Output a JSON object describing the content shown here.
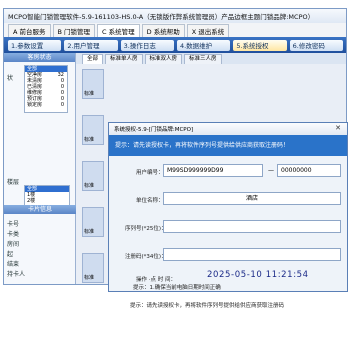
{
  "window": {
    "title": "MCPO智能门锁管理软件-5.9-161103-HS.0-A（无锁版作弊系统管理员）产品边框主题门锁品牌:MCPO）"
  },
  "menubar": {
    "items": [
      "A  前台服务",
      "B  门锁管理",
      "C  系统管理",
      "D  系统帮助",
      "X  退出系统"
    ]
  },
  "tabs": {
    "items": [
      "1.参数设置",
      "2.用户管理",
      "3.操作日志",
      "4.数据维护",
      "5.系统授权",
      "6.修改密码"
    ]
  },
  "sidebar": {
    "header": "客房状态",
    "label_status": "状",
    "label_floor": "楼层",
    "status_rows": [
      {
        "label": "全部",
        "count": ""
      },
      {
        "label": "空净房",
        "count": "32"
      },
      {
        "label": "未清房",
        "count": "0"
      },
      {
        "label": "已清房",
        "count": "0"
      },
      {
        "label": "维修房",
        "count": "0"
      },
      {
        "label": "预订房",
        "count": "0"
      },
      {
        "label": "锁定房",
        "count": "0"
      }
    ],
    "floors": [
      "全部",
      "1楼",
      "2楼"
    ],
    "footer_header": "卡片信息",
    "card_labels": [
      "卡号",
      "卡类",
      "房间",
      "起",
      "结束",
      "持卡人"
    ]
  },
  "room_tabs": {
    "items": [
      "全部",
      "标准单人房",
      "标准双人房",
      "标准三人房"
    ]
  },
  "room_card": {
    "label": "标准"
  },
  "dialog": {
    "title": "系统授权-5.9-[门锁品牌:MCPO]",
    "notice": "提示：请先读授权卡，再将软件序列号提供给供应商获取注册码！",
    "user_code_label": "用户编号：",
    "user_code_value": "M99SD999999D99",
    "user_code_sep": "—",
    "user_code_suffix": "00000000",
    "hotel_label": "单位名称：",
    "hotel_value": "酒店",
    "serial_label": "序列号(*25位)：",
    "reg_label": "注册码(*34位)：",
    "time_label": "操作 ·点 时 间：",
    "time_value": "2025-05-10 11:21:54",
    "hint1": "提示：1.确保当前电脑日期时间正确",
    "hint2": "提示：请先读授权卡，再将软件序列号提供给供应商获取注册码"
  }
}
